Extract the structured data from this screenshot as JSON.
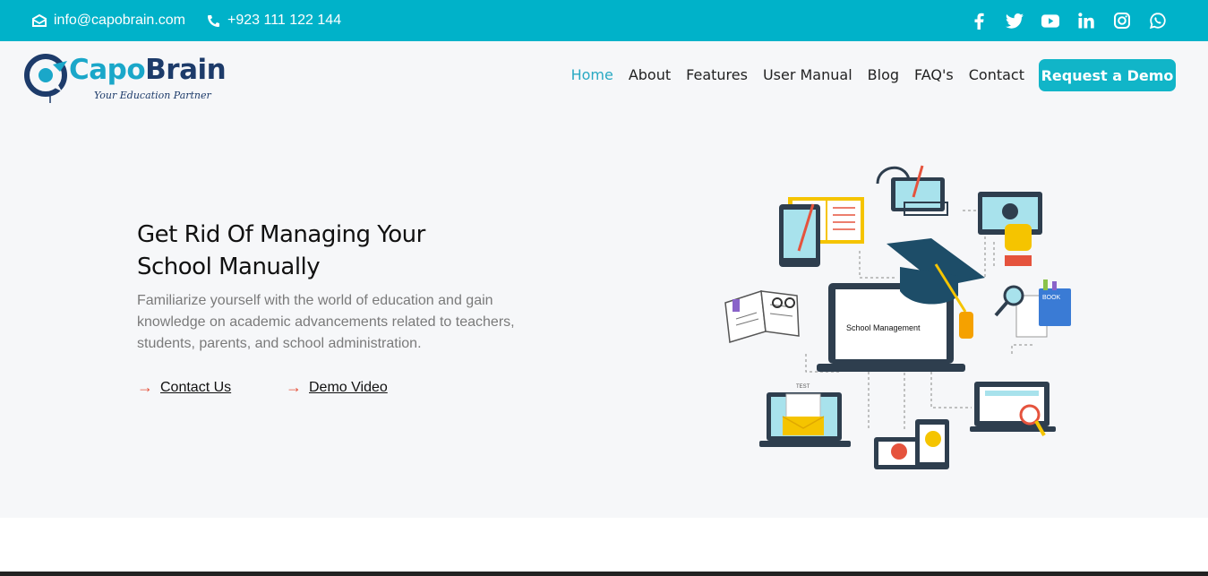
{
  "topbar": {
    "email": "info@capobrain.com",
    "phone": "+923 111 122 144",
    "socials": [
      "facebook",
      "twitter",
      "youtube",
      "linkedin",
      "instagram",
      "whatsapp"
    ]
  },
  "logo": {
    "name_part1": "Capo",
    "name_part2": "Brain",
    "tagline": "Your Education Partner"
  },
  "nav": {
    "items": [
      "Home",
      "About",
      "Features",
      "User Manual",
      "Blog",
      "FAQ's",
      "Contact"
    ],
    "active": "Home",
    "cta": "Request a Demo"
  },
  "hero": {
    "title": "Get Rid Of Managing Your School Manually",
    "description": "Familiarize yourself with the world of education and gain knowledge on academic advancements related to teachers, students, parents, and school administration.",
    "link_contact": "Contact Us",
    "link_demo": "Demo Video",
    "illustration_label": "School Management",
    "illustration_book_label": "BOOK",
    "illustration_test_label": "TEST"
  },
  "colors": {
    "accent": "#00b2c9",
    "brand_dark": "#1d3b6a",
    "link_arrow": "#e5533d"
  }
}
